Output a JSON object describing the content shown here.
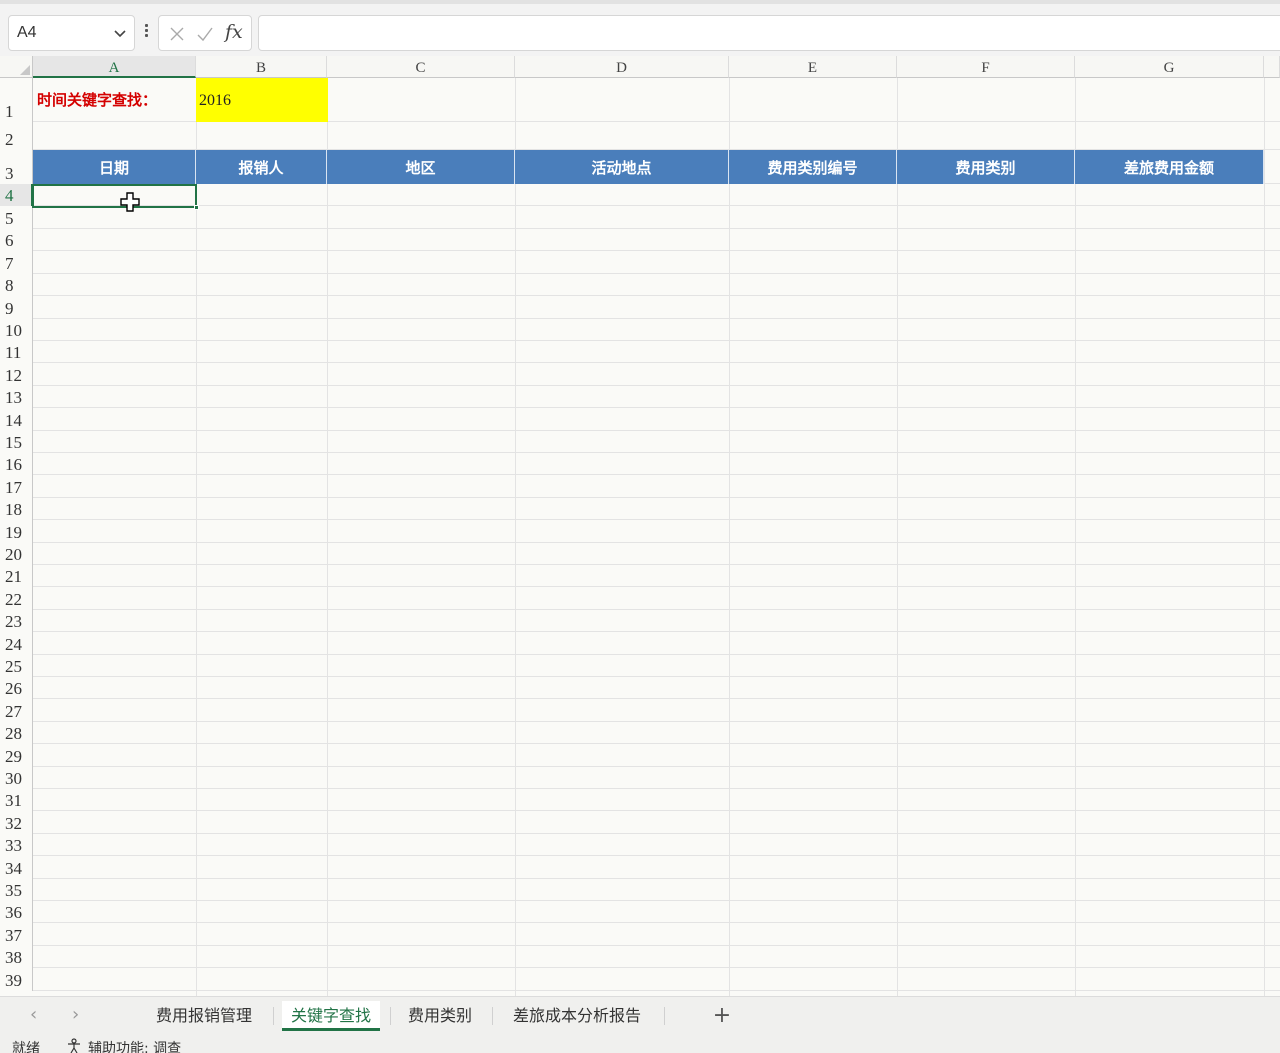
{
  "formula_bar": {
    "name_box": "A4",
    "fx_label": "fx",
    "formula": ""
  },
  "columns": [
    "A",
    "B",
    "C",
    "D",
    "E",
    "F",
    "G"
  ],
  "active_column": "A",
  "rows": [
    "1",
    "2",
    "3",
    "4",
    "5",
    "6",
    "7",
    "8",
    "9",
    "10",
    "11",
    "12",
    "13",
    "14",
    "15",
    "16",
    "17",
    "18",
    "19",
    "20",
    "21",
    "22",
    "23",
    "24",
    "25",
    "26",
    "27",
    "28",
    "29",
    "30",
    "31",
    "32",
    "33",
    "34",
    "35",
    "36",
    "37",
    "38",
    "39"
  ],
  "active_row": "4",
  "cells": {
    "A1": "时间关键字查找：",
    "B1": "2016",
    "header_row": [
      "日期",
      "报销人",
      "地区",
      "活动地点",
      "费用类别编号",
      "费用类别",
      "差旅费用金额"
    ]
  },
  "sheet_tabs": [
    "费用报销管理",
    "关键字查找",
    "费用类别",
    "差旅成本分析报告"
  ],
  "active_tab": "关键字查找",
  "add_tab": "+",
  "status": {
    "ready": "就绪",
    "accessibility": "辅助功能: 调查"
  },
  "colors": {
    "header_fill": "#4a7ebb",
    "highlight_fill": "#ffff00",
    "label_red": "#d40000",
    "excel_green": "#217346"
  }
}
